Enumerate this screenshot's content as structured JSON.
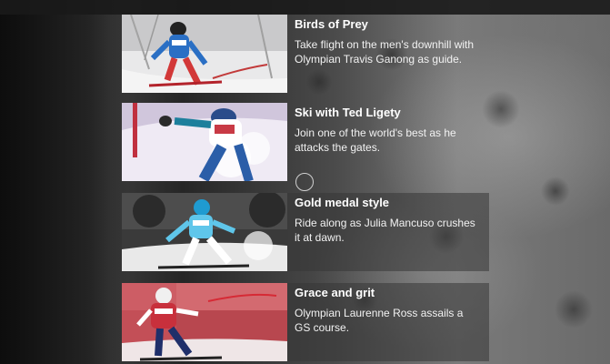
{
  "articles": [
    {
      "title": "Birds of Prey",
      "description": "Take flight on the men's downhill with Olympian Travis Ganong as guide.",
      "image_icon": "downhill-skier-image"
    },
    {
      "title": "Ski with Ted Ligety",
      "description": "Join one of the world's best as he attacks the gates.",
      "image_icon": "giant-slalom-skier-image"
    },
    {
      "title": "Gold medal style",
      "description": "Ride along as Julia Mancuso crushes it at dawn.",
      "image_icon": "super-g-skier-image"
    },
    {
      "title": "Grace and grit",
      "description": "Olympian Laurenne Ross assails a GS course.",
      "image_icon": "gs-skier-image"
    }
  ],
  "colors": {
    "title_text": "#ffffff",
    "description_text": "#f2f2f2",
    "panel_overlay": "rgba(55,55,55,0.55)"
  }
}
